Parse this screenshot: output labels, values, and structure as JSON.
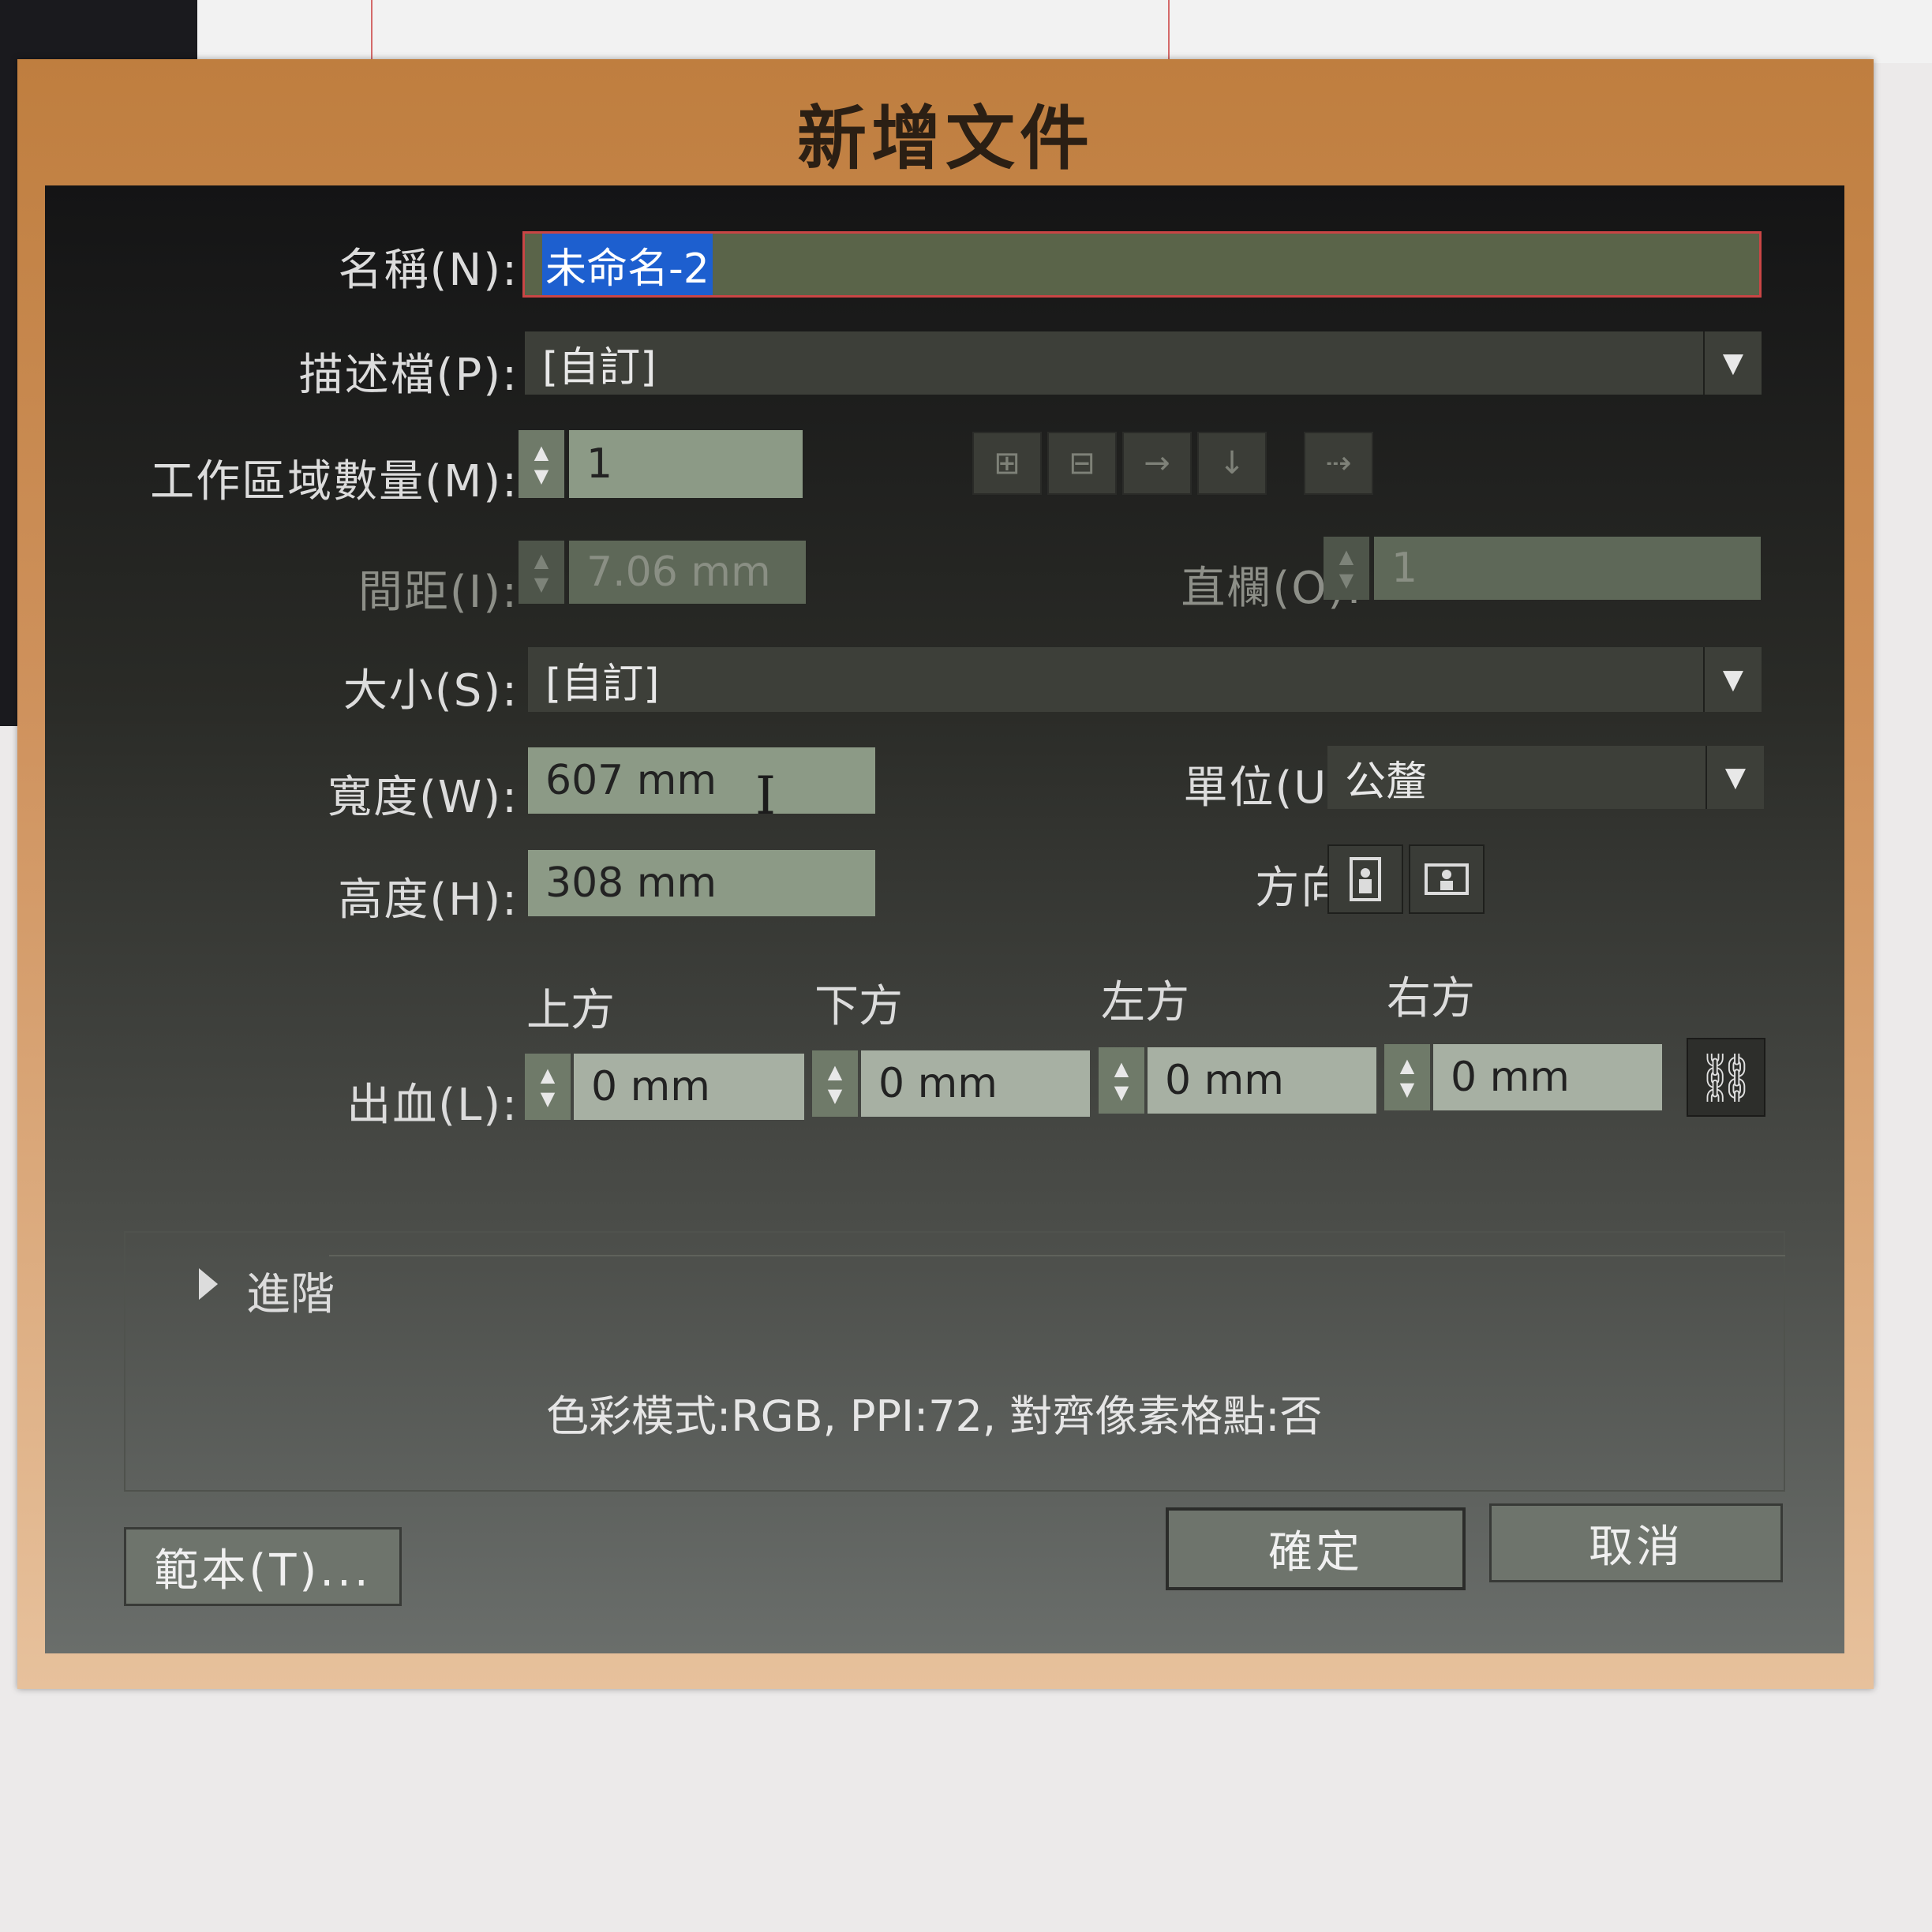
{
  "dialog": {
    "title": "新增文件"
  },
  "name": {
    "label": "名稱(N):",
    "value": "未命名-2"
  },
  "profile": {
    "label": "描述檔(P):",
    "value": "[自訂]"
  },
  "artboards": {
    "label": "工作區域數量(M):",
    "value": "1"
  },
  "spacing": {
    "label": "間距(I):",
    "value": "7.06 mm"
  },
  "columns": {
    "label": "直欄(O):",
    "value": "1"
  },
  "size": {
    "label": "大小(S):",
    "value": "[自訂]"
  },
  "width": {
    "label": "寬度(W):",
    "value": "607 mm"
  },
  "units": {
    "label": "單位(U):",
    "value": "公釐"
  },
  "height": {
    "label": "高度(H):",
    "value": "308 mm"
  },
  "orientation": {
    "label": "方向:"
  },
  "bleed": {
    "label": "出血(L):",
    "top": {
      "label": "上方",
      "value": "0 mm"
    },
    "bottom": {
      "label": "下方",
      "value": "0 mm"
    },
    "left": {
      "label": "左方",
      "value": "0 mm"
    },
    "right": {
      "label": "右方",
      "value": "0 mm"
    }
  },
  "advanced": {
    "label": "進階"
  },
  "info_line": "色彩模式:RGB, PPI:72, 對齊像素格點:否",
  "buttons": {
    "templates": "範本(T)...",
    "ok": "確定",
    "cancel": "取消"
  },
  "icons": {
    "dropdown": "chevron-down-icon",
    "spinner": "spinner-arrows-icon",
    "link": "chain-link-icon",
    "expand": "triangle-right-icon"
  },
  "colors": {
    "accent_select": "#1d5fcf",
    "title_bar": "#bf7e3f",
    "focus_border": "#c94545"
  }
}
